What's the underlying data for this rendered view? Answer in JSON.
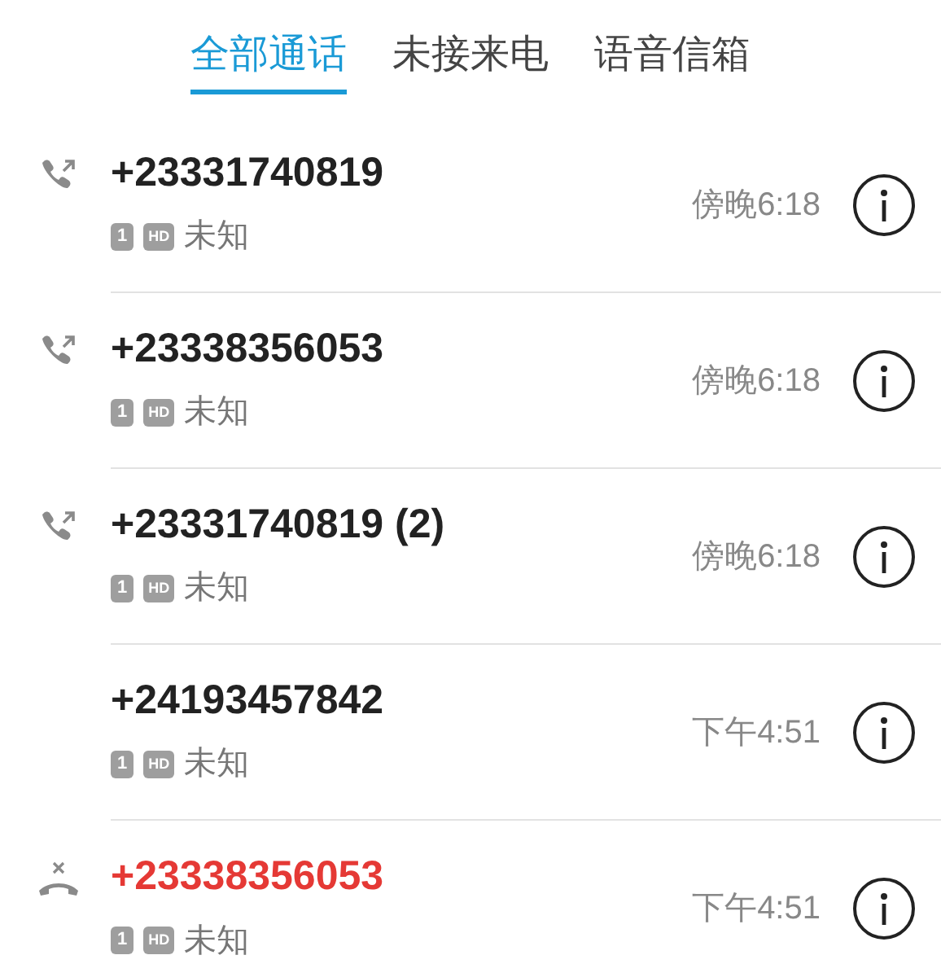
{
  "tabs": [
    {
      "label": "全部通话",
      "selected": true
    },
    {
      "label": "未接来电",
      "selected": false
    },
    {
      "label": "语音信箱",
      "selected": false
    }
  ],
  "calls": [
    {
      "kind": "outgoing",
      "number": "+23331740819",
      "sim": "1",
      "hd": "HD",
      "location": "未知",
      "time": "傍晚6:18",
      "missed": false
    },
    {
      "kind": "outgoing",
      "number": "+23338356053",
      "sim": "1",
      "hd": "HD",
      "location": "未知",
      "time": "傍晚6:18",
      "missed": false
    },
    {
      "kind": "outgoing",
      "number": "+23331740819 (2)",
      "sim": "1",
      "hd": "HD",
      "location": "未知",
      "time": "傍晚6:18",
      "missed": false
    },
    {
      "kind": "none",
      "number": "+24193457842",
      "sim": "1",
      "hd": "HD",
      "location": "未知",
      "time": "下午4:51",
      "missed": false
    },
    {
      "kind": "missed",
      "number": "+23338356053",
      "sim": "1",
      "hd": "HD",
      "location": "未知",
      "time": "下午4:51",
      "missed": true
    }
  ]
}
